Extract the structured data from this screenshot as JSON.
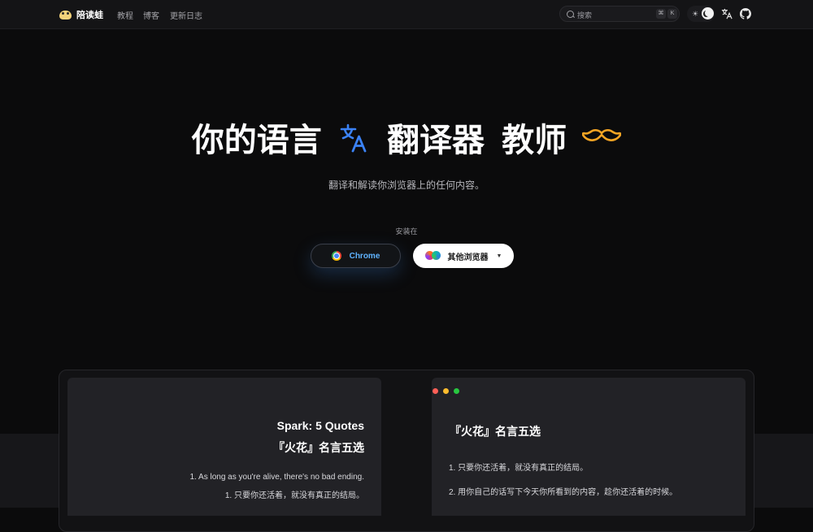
{
  "nav": {
    "brand": "陪读蛙",
    "links": [
      "教程",
      "博客",
      "更新日志"
    ],
    "search_placeholder": "搜索",
    "shortcut_keys": [
      "⌘",
      "K"
    ]
  },
  "hero": {
    "title_part1": "你的语言",
    "title_part2": "翻译器",
    "title_part3": "教师",
    "subtitle": "翻译和解读你浏览器上的任何内容。",
    "install_label": "安装在",
    "chrome_button": "Chrome",
    "other_browsers_button": "其他浏览器"
  },
  "demo": {
    "left": {
      "title_en": "Spark: 5 Quotes",
      "title_zh": "『火花』名言五选",
      "line1_en": "1. As long as you're alive, there's no bad ending.",
      "line1_zh": "1. 只要你还活着，就没有真正的结局。"
    },
    "right": {
      "title": "『火花』名言五选",
      "line1": "1. 只要你还活着，就没有真正的结局。",
      "line2": "2. 用你自己的话写下今天你所看到的内容，趁你还活着的时候。"
    }
  },
  "colors": {
    "accent_blue": "#3b82f6",
    "mustache_orange": "#f5a524",
    "chrome_label": "#5fb3ff",
    "dot_red": "#ff5f57",
    "dot_yellow": "#febc2e",
    "dot_green": "#28c840"
  }
}
